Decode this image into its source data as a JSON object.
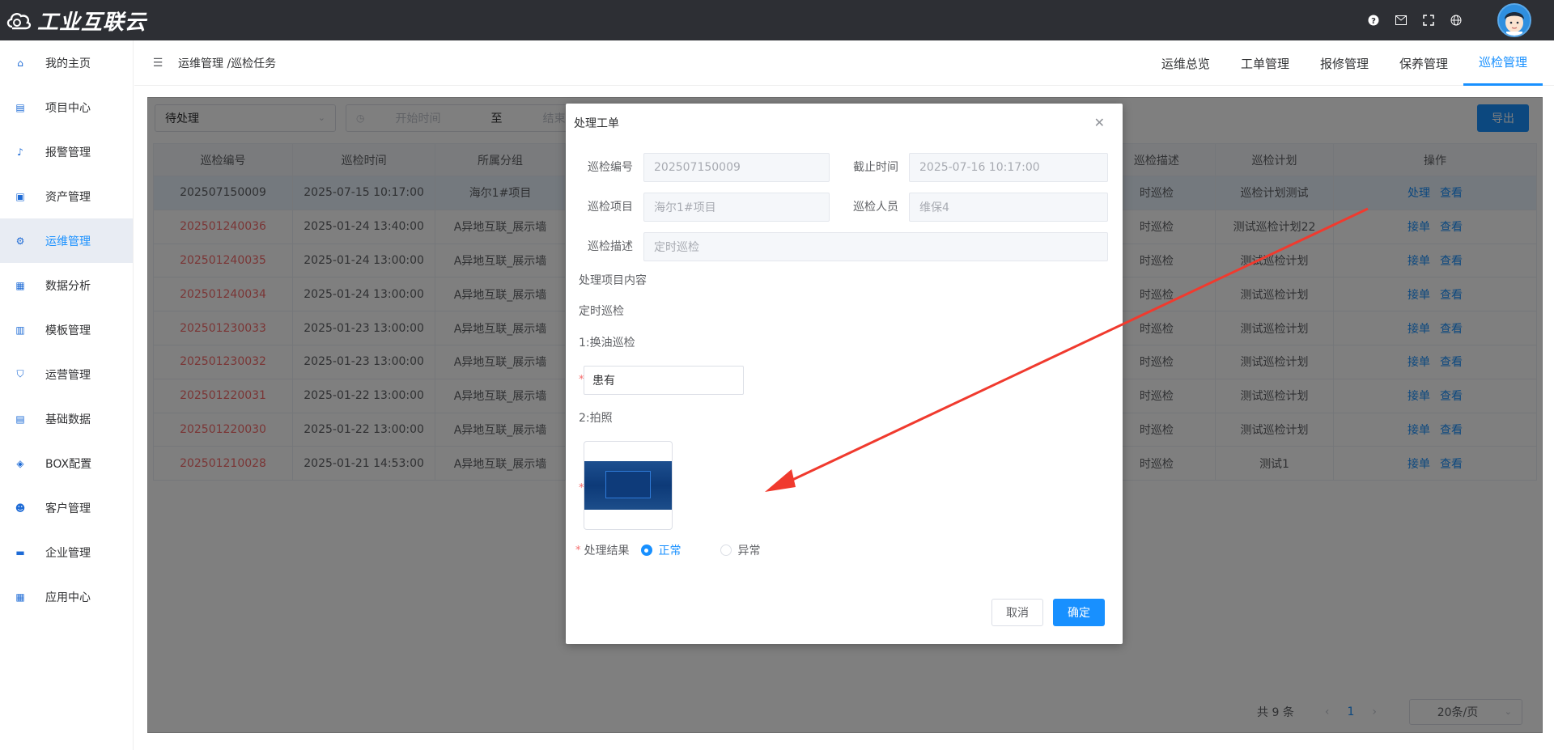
{
  "app": {
    "logo_text": "工业互联云"
  },
  "sidebar": {
    "items": [
      {
        "label": "我的主页",
        "icon": "home-icon"
      },
      {
        "label": "项目中心",
        "icon": "project-icon"
      },
      {
        "label": "报警管理",
        "icon": "bell-icon"
      },
      {
        "label": "资产管理",
        "icon": "asset-icon"
      },
      {
        "label": "运维管理",
        "icon": "gear-icon",
        "active": true
      },
      {
        "label": "数据分析",
        "icon": "analysis-icon"
      },
      {
        "label": "模板管理",
        "icon": "template-icon"
      },
      {
        "label": "运营管理",
        "icon": "shield-icon"
      },
      {
        "label": "基础数据",
        "icon": "book-icon"
      },
      {
        "label": "BOX配置",
        "icon": "box-icon"
      },
      {
        "label": "客户管理",
        "icon": "users-icon"
      },
      {
        "label": "企业管理",
        "icon": "briefcase-icon"
      },
      {
        "label": "应用中心",
        "icon": "apps-icon"
      }
    ]
  },
  "header": {
    "breadcrumb": "运维管理 /巡检任务",
    "tabs": [
      "运维总览",
      "工单管理",
      "报修管理",
      "保养管理",
      "巡检管理"
    ],
    "active_tab": "巡检管理"
  },
  "filters": {
    "status_value": "待处理",
    "start_placeholder": "开始时间",
    "range_separator": "至",
    "end_placeholder": "结束",
    "export_label": "导出"
  },
  "table": {
    "columns": [
      "巡检编号",
      "巡检时间",
      "所属分组",
      "",
      "",
      "",
      "",
      "",
      "巡检描述",
      "巡检计划",
      "操作"
    ],
    "rows": [
      {
        "id": "202507150009",
        "time": "2025-07-15 10:17:00",
        "group": "海尔1#项目",
        "desc": "时巡检",
        "plan": "巡检计划测试",
        "op1": "处理",
        "op2": "查看",
        "red": false,
        "highlight": true
      },
      {
        "id": "202501240036",
        "time": "2025-01-24 13:40:00",
        "group": "A异地互联_展示墙",
        "desc": "时巡检",
        "plan": "测试巡检计划22",
        "op1": "接单",
        "op2": "查看",
        "red": true
      },
      {
        "id": "202501240035",
        "time": "2025-01-24 13:00:00",
        "group": "A异地互联_展示墙",
        "desc": "时巡检",
        "plan": "测试巡检计划",
        "op1": "接单",
        "op2": "查看",
        "red": true
      },
      {
        "id": "202501240034",
        "time": "2025-01-24 13:00:00",
        "group": "A异地互联_展示墙",
        "desc": "时巡检",
        "plan": "测试巡检计划",
        "op1": "接单",
        "op2": "查看",
        "red": true
      },
      {
        "id": "202501230033",
        "time": "2025-01-23 13:00:00",
        "group": "A异地互联_展示墙",
        "desc": "时巡检",
        "plan": "测试巡检计划",
        "op1": "接单",
        "op2": "查看",
        "red": true
      },
      {
        "id": "202501230032",
        "time": "2025-01-23 13:00:00",
        "group": "A异地互联_展示墙",
        "desc": "时巡检",
        "plan": "测试巡检计划",
        "op1": "接单",
        "op2": "查看",
        "red": true
      },
      {
        "id": "202501220031",
        "time": "2025-01-22 13:00:00",
        "group": "A异地互联_展示墙",
        "desc": "时巡检",
        "plan": "测试巡检计划",
        "op1": "接单",
        "op2": "查看",
        "red": true
      },
      {
        "id": "202501220030",
        "time": "2025-01-22 13:00:00",
        "group": "A异地互联_展示墙",
        "desc": "时巡检",
        "plan": "测试巡检计划",
        "op1": "接单",
        "op2": "查看",
        "red": true
      },
      {
        "id": "202501210028",
        "time": "2025-01-21 14:53:00",
        "group": "A异地互联_展示墙",
        "desc": "时巡检",
        "plan": "测试1",
        "op1": "接单",
        "op2": "查看",
        "red": true
      }
    ]
  },
  "pagination": {
    "total": "共 9 条",
    "current": "1",
    "page_size": "20条/页"
  },
  "modal": {
    "title": "处理工单",
    "fields": {
      "id_label": "巡检编号",
      "id_value": "202507150009",
      "deadline_label": "截止时间",
      "deadline_value": "2025-07-16 10:17:00",
      "project_label": "巡检项目",
      "project_value": "海尔1#项目",
      "person_label": "巡检人员",
      "person_value": "维保4",
      "desc_label": "巡检描述",
      "desc_value": "定时巡检"
    },
    "content_heading": "处理项目内容",
    "content_sub": "定时巡检",
    "item1_label": "1:换油巡检",
    "item1_value": "患有",
    "item2_label": "2:拍照",
    "result_label": "处理结果",
    "result_options": [
      "正常",
      "异常"
    ],
    "result_selected": "正常",
    "cancel_label": "取消",
    "ok_label": "确定"
  },
  "colors": {
    "primary": "#1890ff",
    "topbar": "#2d2f34",
    "danger": "#f56c6c",
    "annotation_arrow": "#f03a2e"
  }
}
